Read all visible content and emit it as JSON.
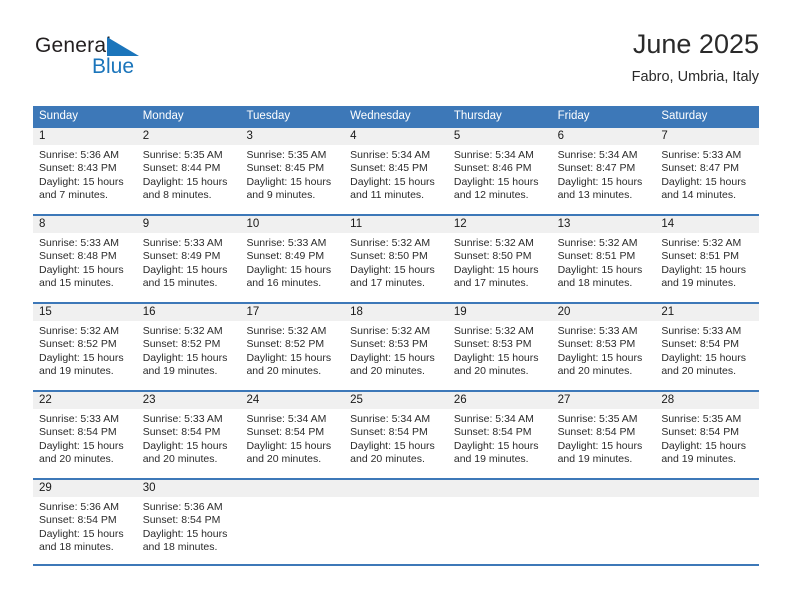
{
  "brand": {
    "name_part1": "General",
    "name_part2": "Blue",
    "mark": "triangle-icon",
    "color_primary": "#1b75bb",
    "color_text": "#231f20"
  },
  "header": {
    "title": "June 2025",
    "subtitle": "Fabro, Umbria, Italy"
  },
  "theme": {
    "accent": "#3d78b8",
    "day_band": "#f0f0f0",
    "text": "#2b2b2b"
  },
  "weekdays": [
    "Sunday",
    "Monday",
    "Tuesday",
    "Wednesday",
    "Thursday",
    "Friday",
    "Saturday"
  ],
  "weeks": [
    [
      {
        "day": "1",
        "sunrise": "Sunrise: 5:36 AM",
        "sunset": "Sunset: 8:43 PM",
        "daylight1": "Daylight: 15 hours",
        "daylight2": "and 7 minutes."
      },
      {
        "day": "2",
        "sunrise": "Sunrise: 5:35 AM",
        "sunset": "Sunset: 8:44 PM",
        "daylight1": "Daylight: 15 hours",
        "daylight2": "and 8 minutes."
      },
      {
        "day": "3",
        "sunrise": "Sunrise: 5:35 AM",
        "sunset": "Sunset: 8:45 PM",
        "daylight1": "Daylight: 15 hours",
        "daylight2": "and 9 minutes."
      },
      {
        "day": "4",
        "sunrise": "Sunrise: 5:34 AM",
        "sunset": "Sunset: 8:45 PM",
        "daylight1": "Daylight: 15 hours",
        "daylight2": "and 11 minutes."
      },
      {
        "day": "5",
        "sunrise": "Sunrise: 5:34 AM",
        "sunset": "Sunset: 8:46 PM",
        "daylight1": "Daylight: 15 hours",
        "daylight2": "and 12 minutes."
      },
      {
        "day": "6",
        "sunrise": "Sunrise: 5:34 AM",
        "sunset": "Sunset: 8:47 PM",
        "daylight1": "Daylight: 15 hours",
        "daylight2": "and 13 minutes."
      },
      {
        "day": "7",
        "sunrise": "Sunrise: 5:33 AM",
        "sunset": "Sunset: 8:47 PM",
        "daylight1": "Daylight: 15 hours",
        "daylight2": "and 14 minutes."
      }
    ],
    [
      {
        "day": "8",
        "sunrise": "Sunrise: 5:33 AM",
        "sunset": "Sunset: 8:48 PM",
        "daylight1": "Daylight: 15 hours",
        "daylight2": "and 15 minutes."
      },
      {
        "day": "9",
        "sunrise": "Sunrise: 5:33 AM",
        "sunset": "Sunset: 8:49 PM",
        "daylight1": "Daylight: 15 hours",
        "daylight2": "and 15 minutes."
      },
      {
        "day": "10",
        "sunrise": "Sunrise: 5:33 AM",
        "sunset": "Sunset: 8:49 PM",
        "daylight1": "Daylight: 15 hours",
        "daylight2": "and 16 minutes."
      },
      {
        "day": "11",
        "sunrise": "Sunrise: 5:32 AM",
        "sunset": "Sunset: 8:50 PM",
        "daylight1": "Daylight: 15 hours",
        "daylight2": "and 17 minutes."
      },
      {
        "day": "12",
        "sunrise": "Sunrise: 5:32 AM",
        "sunset": "Sunset: 8:50 PM",
        "daylight1": "Daylight: 15 hours",
        "daylight2": "and 17 minutes."
      },
      {
        "day": "13",
        "sunrise": "Sunrise: 5:32 AM",
        "sunset": "Sunset: 8:51 PM",
        "daylight1": "Daylight: 15 hours",
        "daylight2": "and 18 minutes."
      },
      {
        "day": "14",
        "sunrise": "Sunrise: 5:32 AM",
        "sunset": "Sunset: 8:51 PM",
        "daylight1": "Daylight: 15 hours",
        "daylight2": "and 19 minutes."
      }
    ],
    [
      {
        "day": "15",
        "sunrise": "Sunrise: 5:32 AM",
        "sunset": "Sunset: 8:52 PM",
        "daylight1": "Daylight: 15 hours",
        "daylight2": "and 19 minutes."
      },
      {
        "day": "16",
        "sunrise": "Sunrise: 5:32 AM",
        "sunset": "Sunset: 8:52 PM",
        "daylight1": "Daylight: 15 hours",
        "daylight2": "and 19 minutes."
      },
      {
        "day": "17",
        "sunrise": "Sunrise: 5:32 AM",
        "sunset": "Sunset: 8:52 PM",
        "daylight1": "Daylight: 15 hours",
        "daylight2": "and 20 minutes."
      },
      {
        "day": "18",
        "sunrise": "Sunrise: 5:32 AM",
        "sunset": "Sunset: 8:53 PM",
        "daylight1": "Daylight: 15 hours",
        "daylight2": "and 20 minutes."
      },
      {
        "day": "19",
        "sunrise": "Sunrise: 5:32 AM",
        "sunset": "Sunset: 8:53 PM",
        "daylight1": "Daylight: 15 hours",
        "daylight2": "and 20 minutes."
      },
      {
        "day": "20",
        "sunrise": "Sunrise: 5:33 AM",
        "sunset": "Sunset: 8:53 PM",
        "daylight1": "Daylight: 15 hours",
        "daylight2": "and 20 minutes."
      },
      {
        "day": "21",
        "sunrise": "Sunrise: 5:33 AM",
        "sunset": "Sunset: 8:54 PM",
        "daylight1": "Daylight: 15 hours",
        "daylight2": "and 20 minutes."
      }
    ],
    [
      {
        "day": "22",
        "sunrise": "Sunrise: 5:33 AM",
        "sunset": "Sunset: 8:54 PM",
        "daylight1": "Daylight: 15 hours",
        "daylight2": "and 20 minutes."
      },
      {
        "day": "23",
        "sunrise": "Sunrise: 5:33 AM",
        "sunset": "Sunset: 8:54 PM",
        "daylight1": "Daylight: 15 hours",
        "daylight2": "and 20 minutes."
      },
      {
        "day": "24",
        "sunrise": "Sunrise: 5:34 AM",
        "sunset": "Sunset: 8:54 PM",
        "daylight1": "Daylight: 15 hours",
        "daylight2": "and 20 minutes."
      },
      {
        "day": "25",
        "sunrise": "Sunrise: 5:34 AM",
        "sunset": "Sunset: 8:54 PM",
        "daylight1": "Daylight: 15 hours",
        "daylight2": "and 20 minutes."
      },
      {
        "day": "26",
        "sunrise": "Sunrise: 5:34 AM",
        "sunset": "Sunset: 8:54 PM",
        "daylight1": "Daylight: 15 hours",
        "daylight2": "and 19 minutes."
      },
      {
        "day": "27",
        "sunrise": "Sunrise: 5:35 AM",
        "sunset": "Sunset: 8:54 PM",
        "daylight1": "Daylight: 15 hours",
        "daylight2": "and 19 minutes."
      },
      {
        "day": "28",
        "sunrise": "Sunrise: 5:35 AM",
        "sunset": "Sunset: 8:54 PM",
        "daylight1": "Daylight: 15 hours",
        "daylight2": "and 19 minutes."
      }
    ],
    [
      {
        "day": "29",
        "sunrise": "Sunrise: 5:36 AM",
        "sunset": "Sunset: 8:54 PM",
        "daylight1": "Daylight: 15 hours",
        "daylight2": "and 18 minutes."
      },
      {
        "day": "30",
        "sunrise": "Sunrise: 5:36 AM",
        "sunset": "Sunset: 8:54 PM",
        "daylight1": "Daylight: 15 hours",
        "daylight2": "and 18 minutes."
      },
      {
        "day": "",
        "sunrise": "",
        "sunset": "",
        "daylight1": "",
        "daylight2": ""
      },
      {
        "day": "",
        "sunrise": "",
        "sunset": "",
        "daylight1": "",
        "daylight2": ""
      },
      {
        "day": "",
        "sunrise": "",
        "sunset": "",
        "daylight1": "",
        "daylight2": ""
      },
      {
        "day": "",
        "sunrise": "",
        "sunset": "",
        "daylight1": "",
        "daylight2": ""
      },
      {
        "day": "",
        "sunrise": "",
        "sunset": "",
        "daylight1": "",
        "daylight2": ""
      }
    ]
  ]
}
